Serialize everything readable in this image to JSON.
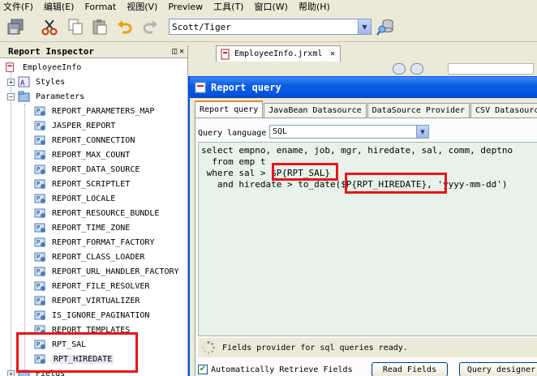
{
  "menubar": {
    "items": [
      "文件(F)",
      "编辑(E)",
      "Format",
      "视图(V)",
      "Preview",
      "工具(T)",
      "窗口(W)",
      "帮助(H)"
    ]
  },
  "toolbar": {
    "connection_value": "Scott/Tiger"
  },
  "inspector": {
    "title": "Report Inspector",
    "root": "EmployeeInfo",
    "styles": "Styles",
    "parameters": "Parameters",
    "param_items": [
      "REPORT_PARAMETERS_MAP",
      "JASPER_REPORT",
      "REPORT_CONNECTION",
      "REPORT_MAX_COUNT",
      "REPORT_DATA_SOURCE",
      "REPORT_SCRIPTLET",
      "REPORT_LOCALE",
      "REPORT_RESOURCE_BUNDLE",
      "REPORT_TIME_ZONE",
      "REPORT_FORMAT_FACTORY",
      "REPORT_CLASS_LOADER",
      "REPORT_URL_HANDLER_FACTORY",
      "REPORT_FILE_RESOLVER",
      "REPORT_VIRTUALIZER",
      "IS_IGNORE_PAGINATION",
      "REPORT_TEMPLATES",
      "RPT_SAL",
      "RPT_HIREDATE"
    ],
    "fields": "Fields"
  },
  "editor": {
    "doc_tab": "EmployeeInfo.jrxml"
  },
  "dialog": {
    "title": "Report query",
    "tabs": [
      "Report query",
      "JavaBean Datasource",
      "DataSource Provider",
      "CSV Datasourc"
    ],
    "query_language_label": "Query language",
    "query_language_value": "SQL",
    "sql": {
      "line1": "select empno, ename, job, mgr, hiredate, sal, comm, deptno",
      "line2": "  from emp t",
      "line3a": " where sal > ",
      "line3b": "$P{RPT_SAL}",
      "line4a": "   and hiredate > to_date(",
      "line4b": "$P{RPT_HIREDATE},",
      "line4c": " 'yyyy-mm-dd')"
    },
    "status_text": "Fields provider for sql queries ready.",
    "auto_retrieve_label": "Automatically Retrieve Fields",
    "read_fields_label": "Read Fields",
    "query_designer_label": "Query designer"
  },
  "colors": {
    "highlight": "#e8141b",
    "title_bar": "#0054e3",
    "sql_bg": "#e6f2ea"
  }
}
